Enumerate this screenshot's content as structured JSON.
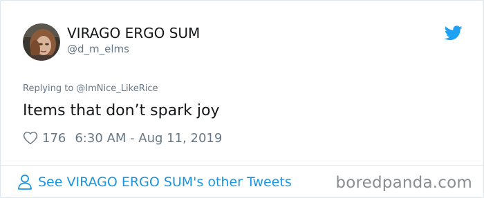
{
  "author": {
    "display_name": "VIRAGO ERGO SUM",
    "handle": "@d_m_elms",
    "avatar": "avatar-photo"
  },
  "brand_icon": "twitter-bird-icon",
  "reply": {
    "prefix": "Replying to",
    "to": "@ImNice_LikeRice"
  },
  "tweet": {
    "text": "Items that don’t spark joy",
    "like_icon": "heart-icon",
    "likes": "176",
    "timestamp": "6:30 AM - Aug 11, 2019"
  },
  "footer": {
    "person_icon": "person-icon",
    "link_label": "See VIRAGO ERGO SUM's other Tweets",
    "watermark": "boredpanda.com"
  },
  "colors": {
    "twitter_blue": "#1da1f2",
    "link_blue": "#1b95e0",
    "secondary_text": "#657786",
    "primary_text": "#14171a",
    "border": "#e1e8ed",
    "watermark": "#8a8d91"
  }
}
